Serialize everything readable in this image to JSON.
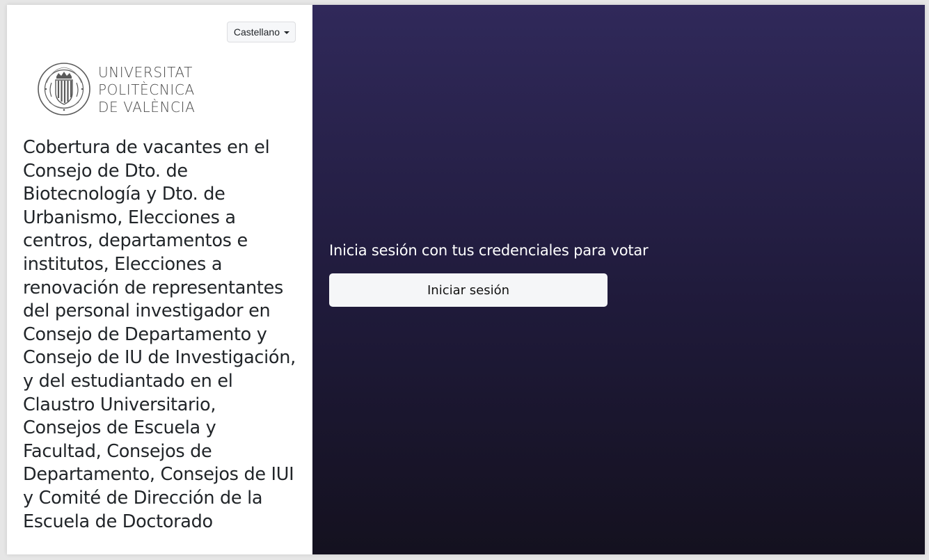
{
  "language_selector": {
    "selected": "Castellano"
  },
  "logo": {
    "line1": "UNIVERSITAT",
    "line2": "POLITÈCNICA",
    "line3": "DE VALÈNCIA",
    "seal_text_top": "UNIVERSITAT POLITÈCNICA",
    "seal_text_bottom": "VALÈNCIA",
    "seal_icon": "university-seal-icon"
  },
  "election": {
    "title": "Cobertura de vacantes en el Consejo de Dto. de Biotecnología y Dto. de Urbanismo, Elecciones a centros, departamentos e institutos, Elecciones a renovación de representantes del personal investigador en Consejo de Departamento y Consejo de IU de Investigación, y del estudiantado en el Claustro Universitario, Consejos de Escuela y Facultad, Consejos de Departamento, Consejos de IUI y Comité de Dirección de la Escuela de Doctorado"
  },
  "login": {
    "prompt": "Inicia sesión con tus credenciales para votar",
    "button_label": "Iniciar sesión"
  },
  "colors": {
    "panel_gradient_top": "#30295a",
    "panel_gradient_bottom": "#14111f",
    "left_panel_bg": "#ffffff",
    "button_bg": "#f5f6f8"
  }
}
